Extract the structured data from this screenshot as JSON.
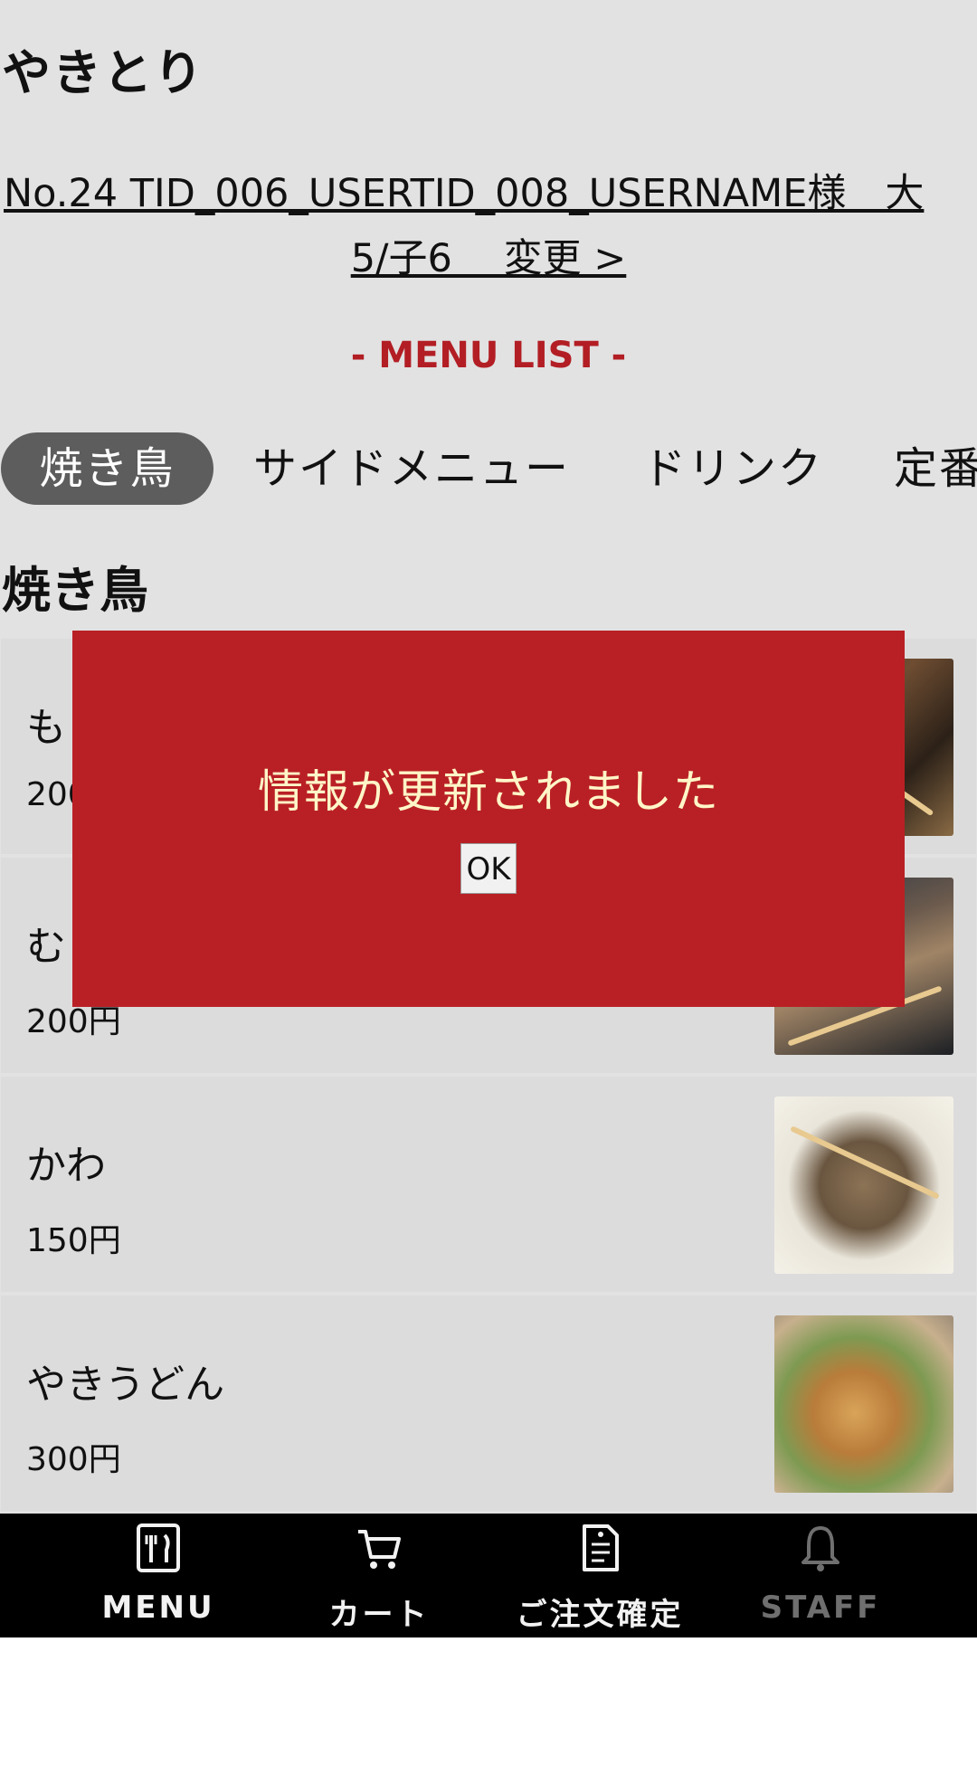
{
  "header": {
    "store_title": "やきとり",
    "table_info_line1": "No.24 TID_006_USERTID_008_USERNAME様　大",
    "table_info_line2": "5/子6　 変更 >"
  },
  "menu_list_heading": "- MENU LIST -",
  "tabs": [
    {
      "label": "焼き鳥",
      "active": true
    },
    {
      "label": "サイドメニュー",
      "active": false
    },
    {
      "label": "ドリンク",
      "active": false
    },
    {
      "label": "定番",
      "active": false
    }
  ],
  "section": {
    "title": "焼き鳥"
  },
  "items": [
    {
      "name": "も",
      "price": "200"
    },
    {
      "name": "む",
      "price": "200円"
    },
    {
      "name": "かわ",
      "price": "150円"
    },
    {
      "name": "やきうどん",
      "price": "300円"
    }
  ],
  "bottom_nav": [
    {
      "label": "MENU",
      "icon": "menu-icon"
    },
    {
      "label": "カート",
      "icon": "cart-icon"
    },
    {
      "label": "ご注文確定",
      "icon": "order-icon"
    },
    {
      "label": "STAFF",
      "icon": "bell-icon",
      "disabled": true
    }
  ],
  "dialog": {
    "message": "情報が更新されました",
    "ok_label": "OK"
  },
  "colors": {
    "accent": "#b21e24",
    "dialog_bg": "#b92025",
    "dialog_text": "#fff6c8",
    "page_bg": "#e2e2e2",
    "nav_bg": "#000000"
  }
}
